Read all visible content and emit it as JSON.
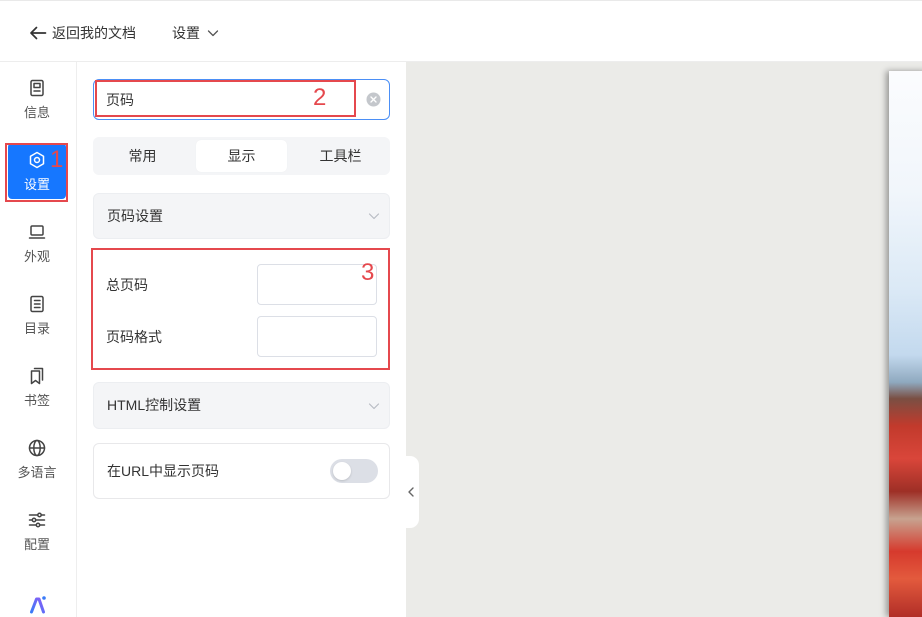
{
  "header": {
    "back_label": "返回我的文档",
    "back_icon": "arrow-left-icon",
    "menu_label": "设置",
    "menu_icon": "chevron-down-icon"
  },
  "sidebar": {
    "items": [
      {
        "label": "信息",
        "icon": "info-icon",
        "active": false
      },
      {
        "label": "设置",
        "icon": "settings-icon",
        "active": true
      },
      {
        "label": "外观",
        "icon": "laptop-icon",
        "active": false
      },
      {
        "label": "目录",
        "icon": "list-icon",
        "active": false
      },
      {
        "label": "书签",
        "icon": "bookmark-icon",
        "active": false
      },
      {
        "label": "多语言",
        "icon": "globe-icon",
        "active": false
      },
      {
        "label": "配置",
        "icon": "sliders-icon",
        "active": false
      }
    ],
    "footer_icon": "ai-logo-icon"
  },
  "search": {
    "value": "页码",
    "clear_icon": "clear-icon"
  },
  "tabs": [
    {
      "label": "常用",
      "active": false
    },
    {
      "label": "显示",
      "active": true
    },
    {
      "label": "工具栏",
      "active": false
    }
  ],
  "page_number_settings": {
    "title": "页码设置",
    "expanded": false,
    "fields": [
      {
        "label": "总页码",
        "value": ""
      },
      {
        "label": "页码格式",
        "value": ""
      }
    ]
  },
  "html_control_settings": {
    "title": "HTML控制设置",
    "expanded": false
  },
  "url_page_toggle": {
    "label": "在URL中显示页码",
    "on": false
  },
  "annotations": {
    "marker_1": "1",
    "marker_2": "2",
    "marker_3": "3"
  },
  "colors": {
    "accent": "#1677ff",
    "annotation": "#e5484d",
    "canvas": "#ebebe8",
    "section": "#f4f5f7"
  }
}
